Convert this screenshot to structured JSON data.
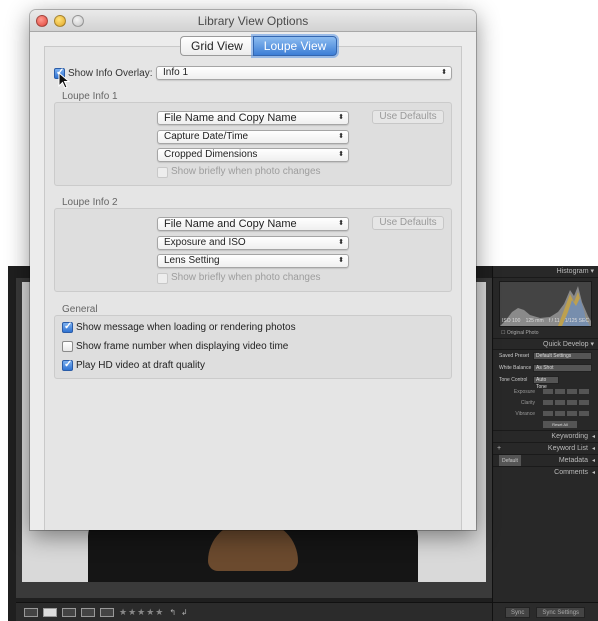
{
  "dialog": {
    "title": "Library View Options",
    "tabs": [
      {
        "label": "Grid View",
        "selected": false
      },
      {
        "label": "Loupe View",
        "selected": true
      }
    ],
    "show_info_overlay": {
      "label": "Show Info Overlay:",
      "checked": true,
      "value": "Info 1"
    },
    "loupe_info_1": {
      "title": "Loupe Info 1",
      "fields": [
        "File Name and Copy Name",
        "Capture Date/Time",
        "Cropped Dimensions"
      ],
      "use_defaults": "Use Defaults",
      "show_briefly": {
        "label": "Show briefly when photo changes",
        "checked": false,
        "enabled": false
      }
    },
    "loupe_info_2": {
      "title": "Loupe Info 2",
      "fields": [
        "File Name and Copy Name",
        "Exposure and ISO",
        "Lens Setting"
      ],
      "use_defaults": "Use Defaults",
      "show_briefly": {
        "label": "Show briefly when photo changes",
        "checked": false,
        "enabled": false
      }
    },
    "general": {
      "title": "General",
      "options": [
        {
          "label": "Show message when loading or rendering photos",
          "checked": true
        },
        {
          "label": "Show frame number when displaying video time",
          "checked": false
        },
        {
          "label": "Play HD video at draft quality",
          "checked": true
        }
      ]
    }
  },
  "lightroom": {
    "panels": {
      "histogram": "Histogram",
      "histogram_info": [
        "ISO 100",
        "125 mm",
        "f / 11",
        "1/125 SEC"
      ],
      "original_photo": "Original Photo",
      "quick_develop": "Quick Develop",
      "saved_preset_label": "Saved Preset",
      "saved_preset_value": "Default Settings",
      "white_balance_label": "White Balance",
      "white_balance_value": "As Shot",
      "tone_control_label": "Tone Control",
      "tone_control_value": "Auto Tone",
      "exposure_label": "Exposure",
      "clarity_label": "Clarity",
      "vibrance_label": "Vibrance",
      "reset_all": "Reset All",
      "keywording": "Keywording",
      "keyword_list": "Keyword List",
      "metadata": "Metadata",
      "metadata_preset": "Default",
      "comments": "Comments",
      "sync": "Sync",
      "sync_settings": "Sync Settings"
    },
    "toolbar_stars": "★★★★★"
  },
  "colors": {
    "accent": "#3d7ed6",
    "lightroom_bg": "#1f1f1f"
  }
}
